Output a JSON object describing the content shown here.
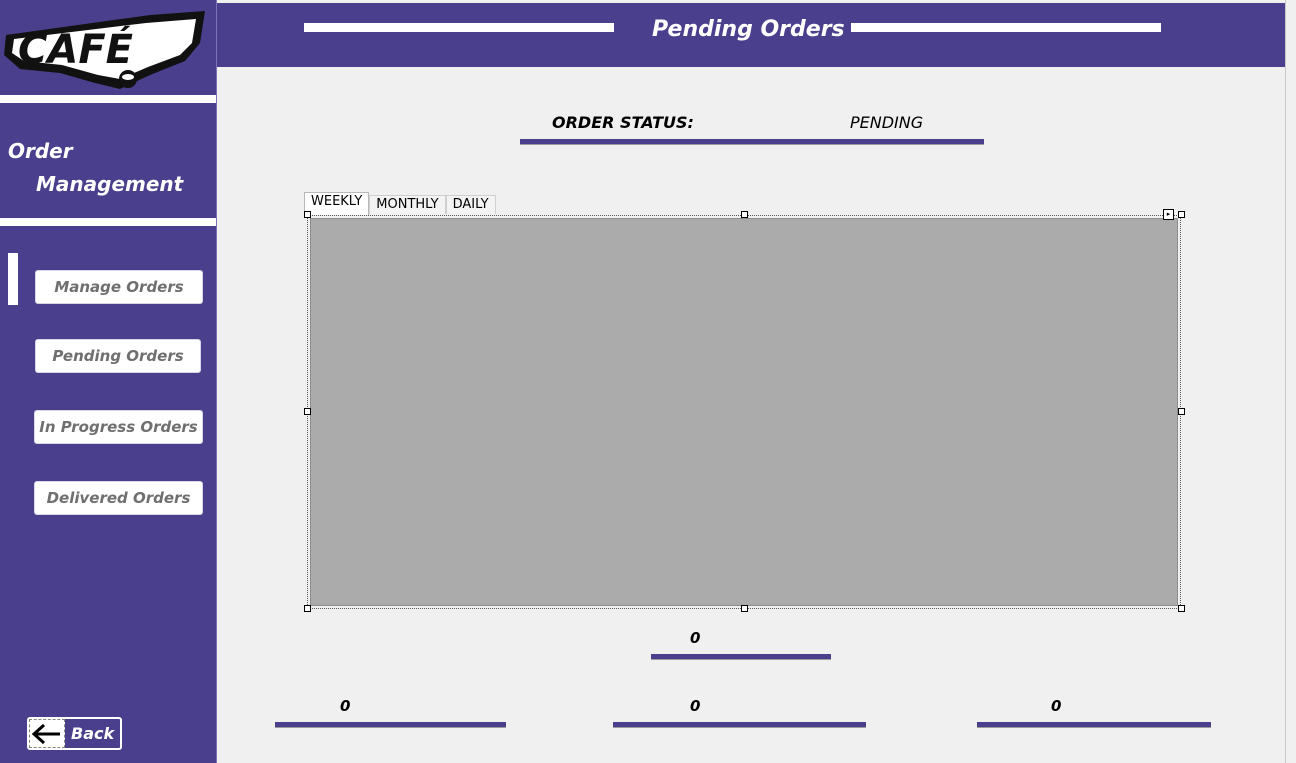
{
  "logo": {
    "text": "CAFÉ"
  },
  "sidebar": {
    "title_line1": "Order",
    "title_line2": "Management",
    "items": [
      {
        "label": "Manage Orders"
      },
      {
        "label": "Pending Orders"
      },
      {
        "label": "In Progress Orders"
      },
      {
        "label": "Delivered Orders"
      }
    ],
    "back_label": "Back"
  },
  "header": {
    "title": "Pending Orders"
  },
  "status": {
    "label": "ORDER STATUS:",
    "value": "PENDING"
  },
  "tabs": [
    {
      "label": "WEEKLY"
    },
    {
      "label": "MONTHLY"
    },
    {
      "label": "DAILY"
    }
  ],
  "counts": {
    "total": "0",
    "left": "0",
    "middle": "0",
    "right": "0"
  },
  "colors": {
    "brand_purple": "#4a3f8c",
    "panel_gray": "#ababab",
    "background": "#f0f0f0"
  }
}
